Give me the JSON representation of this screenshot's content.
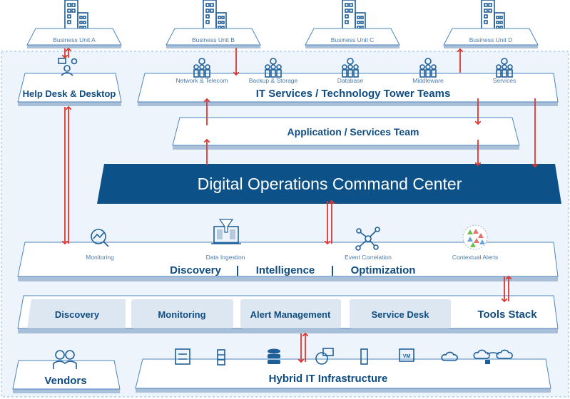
{
  "business_units": [
    "Business Unit A",
    "Business Unit B",
    "Business Unit C",
    "Business Unit D"
  ],
  "help_desk": "Help Desk & Desktop",
  "it_services": {
    "title": "IT Services / Technology Tower Teams",
    "teams": [
      "Network & Telecom",
      "Backup & Storage",
      "Database",
      "Middleware",
      "Services"
    ]
  },
  "app_team": "Application / Services Team",
  "command_center": "Digital Operations Command Center",
  "platform": {
    "capabilities": [
      "Monitoring",
      "Data Ingestion",
      "Event Correlation",
      "Contextual Alerts"
    ],
    "pillars": [
      "Discovery",
      "Intelligence",
      "Optimization"
    ],
    "separator": "|"
  },
  "tools": {
    "items": [
      "Discovery",
      "Monitoring",
      "Alert Management",
      "Service Desk"
    ],
    "title": "Tools Stack"
  },
  "vendors": "Vendors",
  "infrastructure": {
    "title": "Hybrid IT Infrastructure",
    "vm_label": "VM"
  },
  "colors": {
    "primary": "#0d5189",
    "arrow": "#e0342c",
    "background": "#eef4fb"
  }
}
